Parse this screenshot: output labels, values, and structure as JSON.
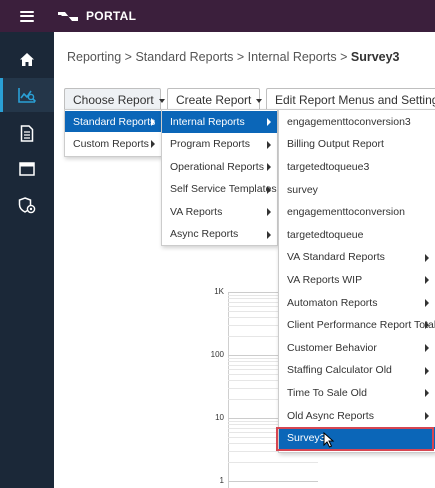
{
  "header": {
    "title": "PORTAL",
    "background": "#3b1f3c"
  },
  "sidebar": {
    "items": [
      {
        "icon": "home-icon"
      },
      {
        "icon": "analytics-icon",
        "active": true
      },
      {
        "icon": "document-icon"
      },
      {
        "icon": "window-icon"
      },
      {
        "icon": "settings-shield-icon"
      }
    ],
    "background": "#1b2838",
    "accent": "#2aa0d6"
  },
  "breadcrumb": {
    "path": "Reporting > Standard Reports > Internal Reports >",
    "current": "Survey3"
  },
  "toolbar": {
    "choose_label": "Choose Report",
    "create_label": "Create Report",
    "edit_label": "Edit Report Menus and Settings"
  },
  "menus": {
    "level1": [
      {
        "label": "Standard Reports",
        "selected": true,
        "submenu": true
      },
      {
        "label": "Custom Reports",
        "submenu": true
      }
    ],
    "level2": [
      {
        "label": "Internal Reports",
        "selected": true,
        "submenu": true
      },
      {
        "label": "Program Reports",
        "submenu": true
      },
      {
        "label": "Operational Reports",
        "submenu": true
      },
      {
        "label": "Self Service Templates",
        "submenu": true
      },
      {
        "label": "VA Reports",
        "submenu": true
      },
      {
        "label": "Async Reports",
        "submenu": true
      }
    ],
    "level3": [
      {
        "label": "engagementtoconversion3"
      },
      {
        "label": "Billing Output Report"
      },
      {
        "label": "targetedtoqueue3"
      },
      {
        "label": "survey"
      },
      {
        "label": "engagementtoconversion"
      },
      {
        "label": "targetedtoqueue"
      },
      {
        "label": "VA Standard Reports",
        "submenu": true
      },
      {
        "label": "VA Reports WIP",
        "submenu": true
      },
      {
        "label": "Automaton Reports",
        "submenu": true
      },
      {
        "label": "Client Performance Report Totals",
        "submenu": true
      },
      {
        "label": "Customer Behavior",
        "submenu": true
      },
      {
        "label": "Staffing Calculator Old",
        "submenu": true
      },
      {
        "label": "Time To Sale Old",
        "submenu": true
      },
      {
        "label": "Old Async Reports",
        "submenu": true
      },
      {
        "label": "Survey3",
        "selected": true
      }
    ],
    "selected_color": "#0b66b8",
    "highlight_border": "#d64652"
  },
  "chart": {
    "scale": "log",
    "ticks": [
      "1K",
      "100",
      "10",
      "1"
    ]
  }
}
